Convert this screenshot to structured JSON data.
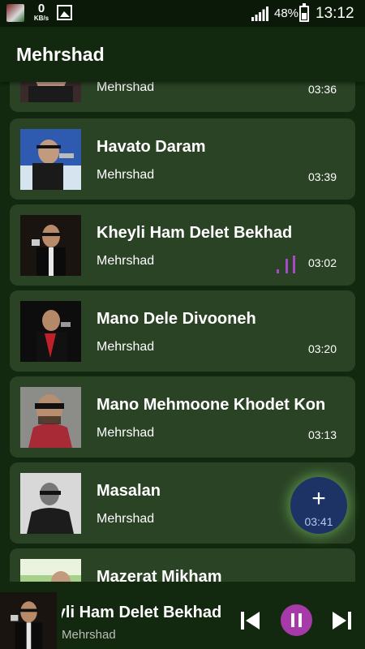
{
  "status_bar": {
    "speed_value": "0",
    "speed_unit": "KB/s",
    "battery": "48%",
    "time": "13:12"
  },
  "app_bar": {
    "title": "Mehrshad"
  },
  "songs": [
    {
      "title": "",
      "artist": "Mehrshad",
      "duration": "03:36"
    },
    {
      "title": "Havato Daram",
      "artist": "Mehrshad",
      "duration": "03:39"
    },
    {
      "title": "Kheyli Ham Delet Bekhad",
      "artist": "Mehrshad",
      "duration": "03:02",
      "playing": true
    },
    {
      "title": "Mano Dele Divooneh",
      "artist": "Mehrshad",
      "duration": "03:20"
    },
    {
      "title": "Mano Mehmoone Khodet Kon",
      "artist": "Mehrshad",
      "duration": "03:13"
    },
    {
      "title": "Masalan",
      "artist": "Mehrshad",
      "duration": "03:41"
    },
    {
      "title": "Mazerat Mikham",
      "artist": "Mehrshad",
      "duration": ""
    }
  ],
  "fab": {
    "icon": "plus-icon",
    "label": "+"
  },
  "player": {
    "title": "Kheyli Ham Delet Bekhad",
    "artist": "Mehrshad"
  },
  "colors": {
    "card": "#2a4325",
    "background": "#13290f",
    "accent": "#a63aa8",
    "fab": "#1d3366"
  }
}
